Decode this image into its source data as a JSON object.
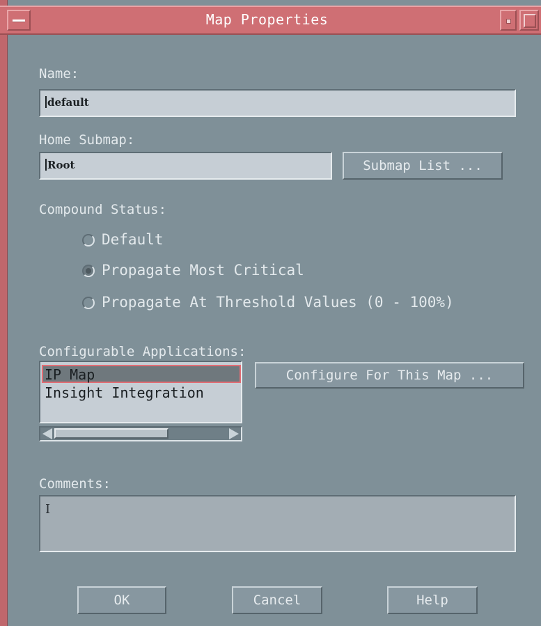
{
  "window": {
    "title": "Map Properties"
  },
  "form": {
    "name_label": "Name:",
    "name_value": "default",
    "home_submap_label": "Home Submap:",
    "home_submap_value": "Root",
    "submap_list_button": "Submap List ...",
    "compound_status_label": "Compound Status:",
    "compound_status_options": [
      {
        "label": "Default",
        "selected": false
      },
      {
        "label": "Propagate Most Critical",
        "selected": true
      },
      {
        "label": "Propagate At Threshold Values (0 - 100%)",
        "selected": false
      }
    ],
    "configurable_apps_label": "Configurable Applications:",
    "configurable_apps": [
      {
        "label": "IP Map",
        "selected": true
      },
      {
        "label": "Insight Integration",
        "selected": false
      }
    ],
    "configure_button": "Configure For This Map ...",
    "comments_label": "Comments:",
    "comments_value": ""
  },
  "buttons": {
    "ok": "OK",
    "cancel": "Cancel",
    "help": "Help"
  },
  "colors": {
    "titlebar": "#cf6f74",
    "background": "#7f9098",
    "field": "#c6ced5",
    "selection_border": "#e16d74"
  },
  "icons": {
    "window_menu": "window-menu-icon",
    "minimize": "minimize-icon",
    "maximize": "maximize-icon",
    "scroll_left": "arrow-left-icon",
    "scroll_right": "arrow-right-icon"
  }
}
